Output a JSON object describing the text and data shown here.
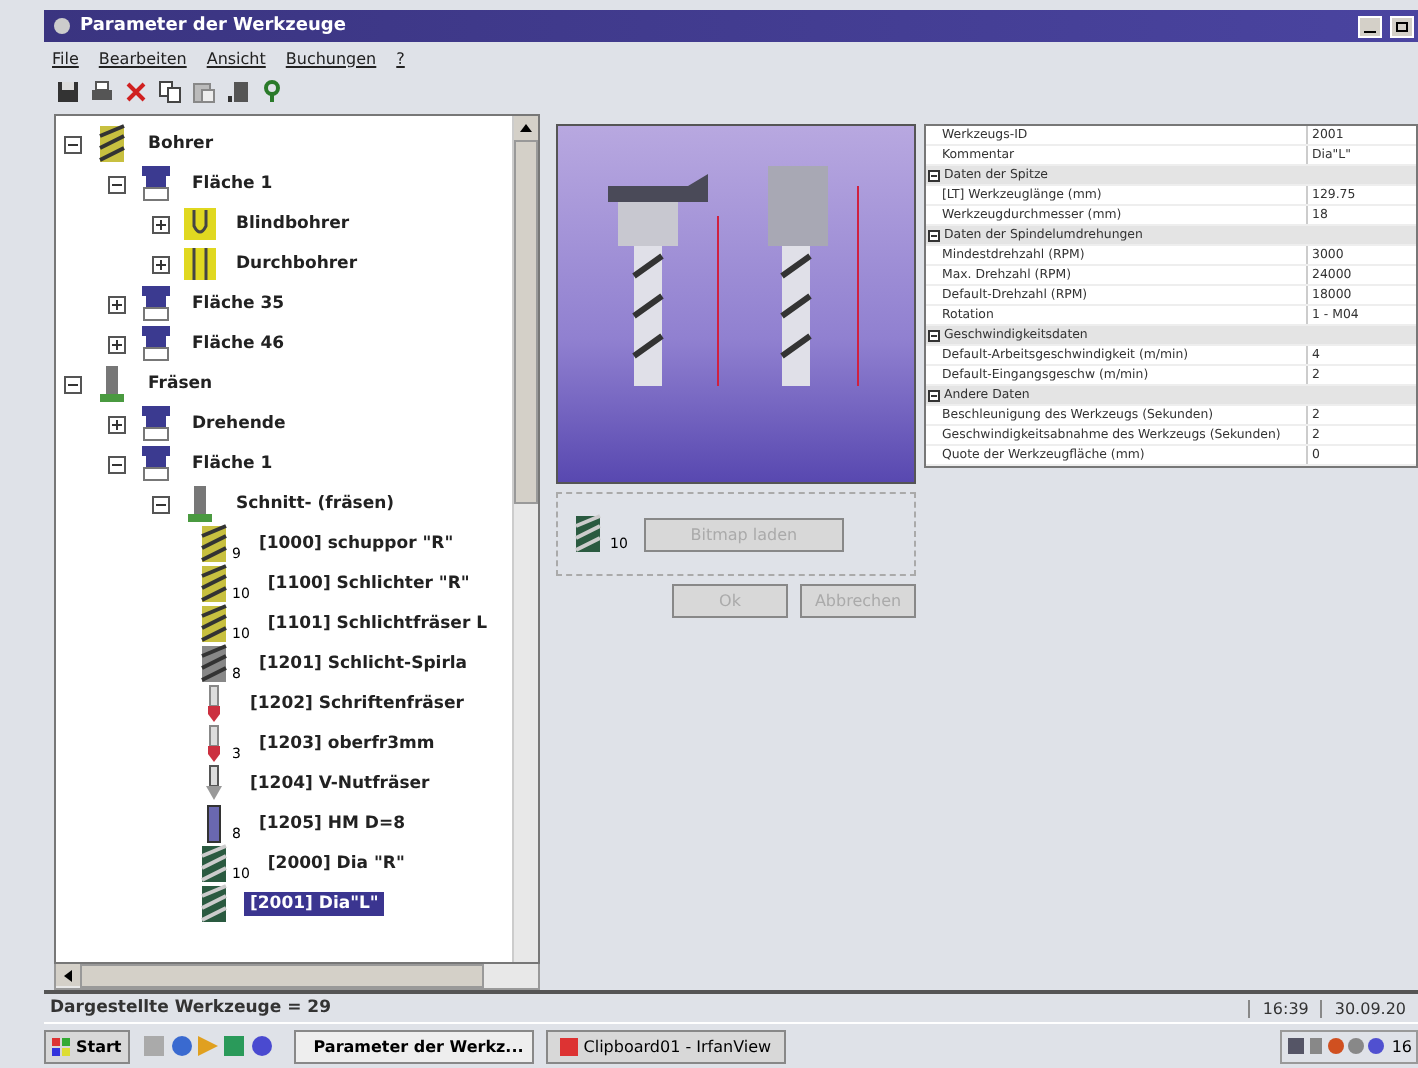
{
  "window": {
    "title": "Parameter der Werkzeuge"
  },
  "menu": [
    "File",
    "Bearbeiten",
    "Ansicht",
    "Buchungen",
    "?"
  ],
  "toolbar": [
    {
      "kind": "save"
    },
    {
      "kind": "print"
    },
    {
      "kind": "delete"
    },
    {
      "kind": "copy"
    },
    {
      "kind": "paste"
    },
    {
      "kind": "export"
    },
    {
      "kind": "help"
    }
  ],
  "tree": [
    {
      "label": "Bohrer",
      "kind": "drill",
      "expanded": true,
      "selected": false,
      "children": [
        {
          "label": "Fläche 1",
          "kind": "face",
          "expanded": true,
          "selected": false,
          "children": [
            {
              "label": "Blindbohrer",
              "kind": "blind",
              "expanded": false,
              "selected": false
            },
            {
              "label": "Durchbohrer",
              "kind": "through",
              "expanded": false,
              "selected": false
            }
          ]
        },
        {
          "label": "Fläche 35",
          "kind": "face",
          "expanded": false,
          "selected": false
        },
        {
          "label": "Fläche 46",
          "kind": "face",
          "expanded": false,
          "selected": false
        }
      ]
    },
    {
      "label": "Fräsen",
      "kind": "mill",
      "expanded": true,
      "selected": false,
      "children": [
        {
          "label": "Drehende",
          "kind": "face",
          "expanded": false,
          "selected": false
        },
        {
          "label": "Fläche 1",
          "kind": "face",
          "expanded": true,
          "selected": false,
          "children": [
            {
              "label": "Schnitt- (fräsen)",
              "kind": "mill",
              "expanded": true,
              "selected": false,
              "children": [
                {
                  "label": "[1000] schuppor \"R\"",
                  "kind": "spiral-yellow",
                  "badge": "9",
                  "selected": false
                },
                {
                  "label": "[1100] Schlichter \"R\"",
                  "kind": "spiral-yellow",
                  "badge": "10",
                  "selected": false
                },
                {
                  "label": "[1101] Schlichtfräser L",
                  "kind": "spiral-yellow",
                  "badge": "10",
                  "selected": false
                },
                {
                  "label": "[1201] Schlicht-Spirla",
                  "kind": "spiral-grey",
                  "badge": "8",
                  "selected": false
                },
                {
                  "label": "[1202] Schriftenfräser",
                  "kind": "red-tip",
                  "selected": false
                },
                {
                  "label": "[1203] oberfr3mm",
                  "kind": "red-tip",
                  "badge": "3",
                  "selected": false
                },
                {
                  "label": "[1204] V-Nutfräser",
                  "kind": "v-tip",
                  "selected": false
                },
                {
                  "label": "[1205] HM D=8",
                  "kind": "rod",
                  "badge": "8",
                  "selected": false
                },
                {
                  "label": "[2000] Dia \"R\"",
                  "kind": "spiral-dark",
                  "badge": "10",
                  "selected": false
                },
                {
                  "label": "[2001] Dia\"L\"",
                  "kind": "spiral-dark",
                  "selected": true
                }
              ]
            }
          ]
        }
      ]
    }
  ],
  "preview": {
    "kind": "picture",
    "tool_badge": "10",
    "load_button": "Bitmap laden",
    "buttons": [
      "Ok",
      "Abbrechen"
    ],
    "disabled": true
  },
  "properties": [
    {
      "kind": "row",
      "name": "Werkzeugs-ID",
      "value": "2001"
    },
    {
      "kind": "row",
      "name": "Kommentar",
      "value": "Dia\"L\""
    },
    {
      "kind": "section",
      "name": "Daten der Spitze",
      "expanded": true
    },
    {
      "kind": "row",
      "name": "[LT] Werkzeuglänge (mm)",
      "value": "129.75"
    },
    {
      "kind": "row",
      "name": "Werkzeugdurchmesser (mm)",
      "value": "18"
    },
    {
      "kind": "section",
      "name": "Daten der Spindelumdrehungen",
      "expanded": true
    },
    {
      "kind": "row",
      "name": "Mindestdrehzahl (RPM)",
      "value": "3000"
    },
    {
      "kind": "row",
      "name": "Max. Drehzahl (RPM)",
      "value": "24000"
    },
    {
      "kind": "row",
      "name": "Default-Drehzahl (RPM)",
      "value": "18000"
    },
    {
      "kind": "row",
      "name": "Rotation",
      "value": "1 - M04"
    },
    {
      "kind": "section",
      "name": "Geschwindigkeitsdaten",
      "expanded": true
    },
    {
      "kind": "row",
      "name": "Default-Arbeitsgeschwindigkeit (m/min)",
      "value": "4"
    },
    {
      "kind": "row",
      "name": "Default-Eingangsgeschw (m/min)",
      "value": "2"
    },
    {
      "kind": "section",
      "name": "Andere Daten",
      "expanded": true
    },
    {
      "kind": "row",
      "name": "Beschleunigung des Werkzeugs (Sekunden)",
      "value": "2"
    },
    {
      "kind": "row",
      "name": "Geschwindigkeitsabnahme des Werkzeugs (Sekunden)",
      "value": "2"
    },
    {
      "kind": "row",
      "name": "Quote der Werkzeugfläche (mm)",
      "value": "0"
    }
  ],
  "status_bar": {
    "text": "Dargestellte Werkzeuge = 29",
    "time": "16:39",
    "date": "30.09.20"
  },
  "taskbar": {
    "start": "Start",
    "tasks": [
      {
        "label": "Parameter der Werkz...",
        "selected": true
      },
      {
        "label": "Clipboard01 - IrfanView",
        "selected": false
      }
    ],
    "clock": "16"
  }
}
